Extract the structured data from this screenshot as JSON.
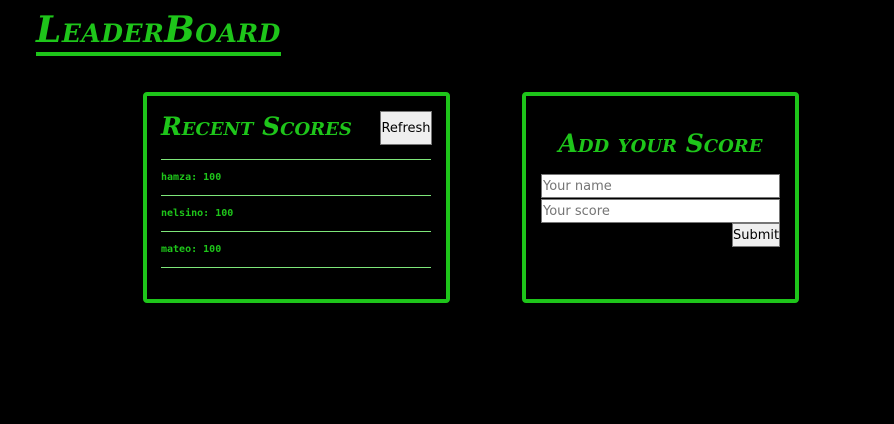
{
  "app": {
    "title": "LeaderBoard"
  },
  "recent": {
    "heading": "Recent Scores",
    "refresh_label": "Refresh",
    "scores": [
      {
        "name": "hamza",
        "score": "100"
      },
      {
        "name": "nelsino",
        "score": "100"
      },
      {
        "name": "mateo",
        "score": "100"
      }
    ]
  },
  "add": {
    "heading": "Add your Score",
    "name_placeholder": "Your name",
    "score_placeholder": "Your score",
    "submit_label": "Submit"
  },
  "colors": {
    "accent": "#1ec51a",
    "background": "#000000",
    "divider": "#7ee77a"
  }
}
